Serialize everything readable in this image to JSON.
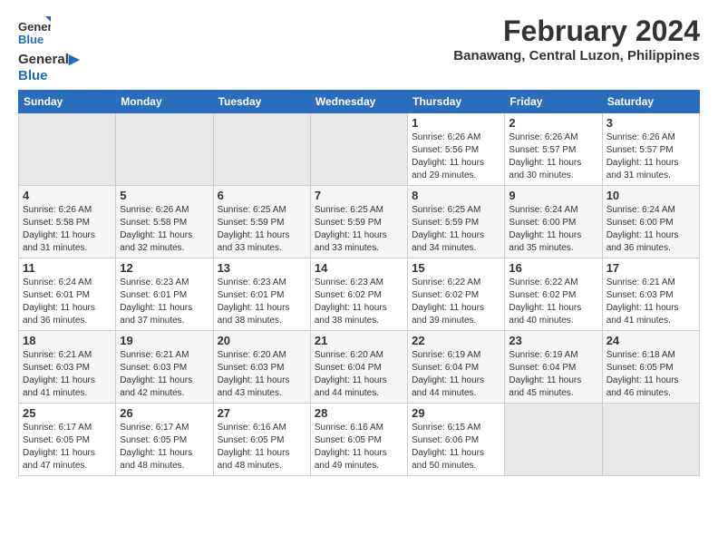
{
  "logo": {
    "line1": "General",
    "line2": "Blue"
  },
  "title": "February 2024",
  "subtitle": "Banawang, Central Luzon, Philippines",
  "days_header": [
    "Sunday",
    "Monday",
    "Tuesday",
    "Wednesday",
    "Thursday",
    "Friday",
    "Saturday"
  ],
  "weeks": [
    [
      {
        "day": "",
        "info": ""
      },
      {
        "day": "",
        "info": ""
      },
      {
        "day": "",
        "info": ""
      },
      {
        "day": "",
        "info": ""
      },
      {
        "day": "1",
        "info": "Sunrise: 6:26 AM\nSunset: 5:56 PM\nDaylight: 11 hours\nand 29 minutes."
      },
      {
        "day": "2",
        "info": "Sunrise: 6:26 AM\nSunset: 5:57 PM\nDaylight: 11 hours\nand 30 minutes."
      },
      {
        "day": "3",
        "info": "Sunrise: 6:26 AM\nSunset: 5:57 PM\nDaylight: 11 hours\nand 31 minutes."
      }
    ],
    [
      {
        "day": "4",
        "info": "Sunrise: 6:26 AM\nSunset: 5:58 PM\nDaylight: 11 hours\nand 31 minutes."
      },
      {
        "day": "5",
        "info": "Sunrise: 6:26 AM\nSunset: 5:58 PM\nDaylight: 11 hours\nand 32 minutes."
      },
      {
        "day": "6",
        "info": "Sunrise: 6:25 AM\nSunset: 5:59 PM\nDaylight: 11 hours\nand 33 minutes."
      },
      {
        "day": "7",
        "info": "Sunrise: 6:25 AM\nSunset: 5:59 PM\nDaylight: 11 hours\nand 33 minutes."
      },
      {
        "day": "8",
        "info": "Sunrise: 6:25 AM\nSunset: 5:59 PM\nDaylight: 11 hours\nand 34 minutes."
      },
      {
        "day": "9",
        "info": "Sunrise: 6:24 AM\nSunset: 6:00 PM\nDaylight: 11 hours\nand 35 minutes."
      },
      {
        "day": "10",
        "info": "Sunrise: 6:24 AM\nSunset: 6:00 PM\nDaylight: 11 hours\nand 36 minutes."
      }
    ],
    [
      {
        "day": "11",
        "info": "Sunrise: 6:24 AM\nSunset: 6:01 PM\nDaylight: 11 hours\nand 36 minutes."
      },
      {
        "day": "12",
        "info": "Sunrise: 6:23 AM\nSunset: 6:01 PM\nDaylight: 11 hours\nand 37 minutes."
      },
      {
        "day": "13",
        "info": "Sunrise: 6:23 AM\nSunset: 6:01 PM\nDaylight: 11 hours\nand 38 minutes."
      },
      {
        "day": "14",
        "info": "Sunrise: 6:23 AM\nSunset: 6:02 PM\nDaylight: 11 hours\nand 38 minutes."
      },
      {
        "day": "15",
        "info": "Sunrise: 6:22 AM\nSunset: 6:02 PM\nDaylight: 11 hours\nand 39 minutes."
      },
      {
        "day": "16",
        "info": "Sunrise: 6:22 AM\nSunset: 6:02 PM\nDaylight: 11 hours\nand 40 minutes."
      },
      {
        "day": "17",
        "info": "Sunrise: 6:21 AM\nSunset: 6:03 PM\nDaylight: 11 hours\nand 41 minutes."
      }
    ],
    [
      {
        "day": "18",
        "info": "Sunrise: 6:21 AM\nSunset: 6:03 PM\nDaylight: 11 hours\nand 41 minutes."
      },
      {
        "day": "19",
        "info": "Sunrise: 6:21 AM\nSunset: 6:03 PM\nDaylight: 11 hours\nand 42 minutes."
      },
      {
        "day": "20",
        "info": "Sunrise: 6:20 AM\nSunset: 6:03 PM\nDaylight: 11 hours\nand 43 minutes."
      },
      {
        "day": "21",
        "info": "Sunrise: 6:20 AM\nSunset: 6:04 PM\nDaylight: 11 hours\nand 44 minutes."
      },
      {
        "day": "22",
        "info": "Sunrise: 6:19 AM\nSunset: 6:04 PM\nDaylight: 11 hours\nand 44 minutes."
      },
      {
        "day": "23",
        "info": "Sunrise: 6:19 AM\nSunset: 6:04 PM\nDaylight: 11 hours\nand 45 minutes."
      },
      {
        "day": "24",
        "info": "Sunrise: 6:18 AM\nSunset: 6:05 PM\nDaylight: 11 hours\nand 46 minutes."
      }
    ],
    [
      {
        "day": "25",
        "info": "Sunrise: 6:17 AM\nSunset: 6:05 PM\nDaylight: 11 hours\nand 47 minutes."
      },
      {
        "day": "26",
        "info": "Sunrise: 6:17 AM\nSunset: 6:05 PM\nDaylight: 11 hours\nand 48 minutes."
      },
      {
        "day": "27",
        "info": "Sunrise: 6:16 AM\nSunset: 6:05 PM\nDaylight: 11 hours\nand 48 minutes."
      },
      {
        "day": "28",
        "info": "Sunrise: 6:16 AM\nSunset: 6:05 PM\nDaylight: 11 hours\nand 49 minutes."
      },
      {
        "day": "29",
        "info": "Sunrise: 6:15 AM\nSunset: 6:06 PM\nDaylight: 11 hours\nand 50 minutes."
      },
      {
        "day": "",
        "info": ""
      },
      {
        "day": "",
        "info": ""
      }
    ]
  ]
}
